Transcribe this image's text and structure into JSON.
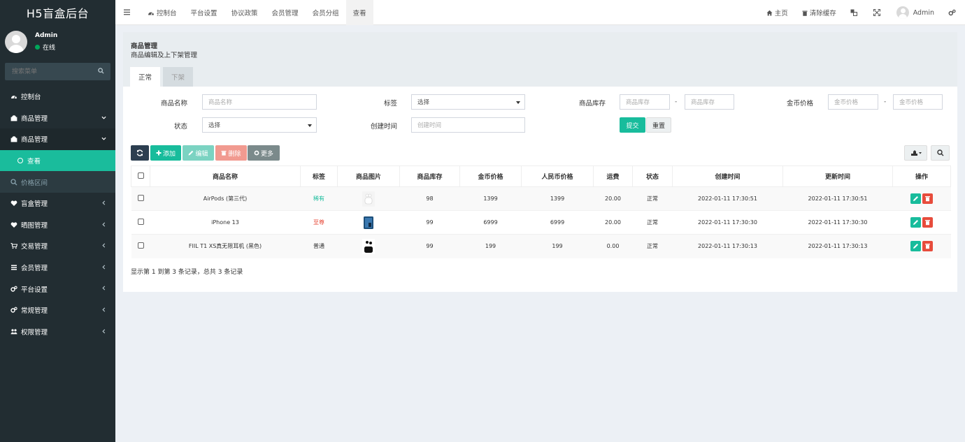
{
  "sidebar": {
    "logo": "H5盲盒后台",
    "user": {
      "name": "Admin",
      "status": "在线"
    },
    "search_placeholder": "搜索菜单",
    "menu": [
      {
        "label": "控制台",
        "icon": "dashboard-icon"
      },
      {
        "label": "商品管理",
        "icon": "shop-icon"
      },
      {
        "label": "商品管理",
        "icon": "shop-icon"
      },
      {
        "label": "查看",
        "icon": "circle-icon"
      },
      {
        "label": "价格区间",
        "icon": "search-icon"
      },
      {
        "label": "盲盒管理",
        "icon": "heart-icon"
      },
      {
        "label": "晒图管理",
        "icon": "heart-icon"
      },
      {
        "label": "交易管理",
        "icon": "cart-icon"
      },
      {
        "label": "会员管理",
        "icon": "list-icon"
      },
      {
        "label": "平台设置",
        "icon": "cogs-icon"
      },
      {
        "label": "常规管理",
        "icon": "cogs-icon"
      },
      {
        "label": "权限管理",
        "icon": "users-icon"
      }
    ]
  },
  "header": {
    "tabs": [
      "控制台",
      "平台设置",
      "协议政策",
      "会员管理",
      "会员分组",
      "查看"
    ],
    "right": {
      "home": "主页",
      "clear_cache": "清除缓存",
      "admin": "Admin"
    }
  },
  "panel": {
    "title": "商品管理",
    "subtitle": "商品编辑及上下架管理",
    "tabs": [
      "正常",
      "下架"
    ]
  },
  "filters": {
    "name_label": "商品名称",
    "name_placeholder": "商品名称",
    "tag_label": "标签",
    "tag_value": "选择",
    "stock_label": "商品库存",
    "stock_min_placeholder": "商品库存",
    "stock_max_placeholder": "商品库存",
    "gold_label": "金币价格",
    "gold_min_placeholder": "金币价格",
    "gold_max_placeholder": "金币价格",
    "status_label": "状态",
    "status_value": "选择",
    "created_label": "创建时间",
    "created_placeholder": "创建时间",
    "dash": "-",
    "submit": "提交",
    "reset": "重置"
  },
  "toolbar": {
    "add": "添加",
    "edit": "编辑",
    "delete": "删除",
    "more": "更多"
  },
  "table": {
    "headers": [
      "商品名称",
      "标签",
      "商品图片",
      "商品库存",
      "金币价格",
      "人民币价格",
      "运费",
      "状态",
      "创建时间",
      "更新时间",
      "操作"
    ],
    "rows": [
      {
        "name": "AirPods (第三代)",
        "tag": "稀有",
        "stock": "98",
        "gold": "1399",
        "rmb": "1399",
        "freight": "20.00",
        "status": "正常",
        "created": "2022-01-11 17:30:51",
        "updated": "2022-01-11 17:30:51"
      },
      {
        "name": "iPhone 13",
        "tag": "至尊",
        "stock": "99",
        "gold": "6999",
        "rmb": "6999",
        "freight": "20.00",
        "status": "正常",
        "created": "2022-01-11 17:30:30",
        "updated": "2022-01-11 17:30:30"
      },
      {
        "name": "FIIL T1 XS真无限耳机 (黑色)",
        "tag": "普通",
        "stock": "99",
        "gold": "199",
        "rmb": "199",
        "freight": "0.00",
        "status": "正常",
        "created": "2022-01-11 17:30:13",
        "updated": "2022-01-11 17:30:13"
      }
    ]
  },
  "footer": "显示第 1 到第 3 条记录，总共 3 条记录",
  "colors": {
    "sidebar": "#222d32",
    "accent": "#18bc9c",
    "danger": "#e74c3c",
    "dark_btn": "#2c3e50",
    "muted_btn": "#95a5a6"
  }
}
